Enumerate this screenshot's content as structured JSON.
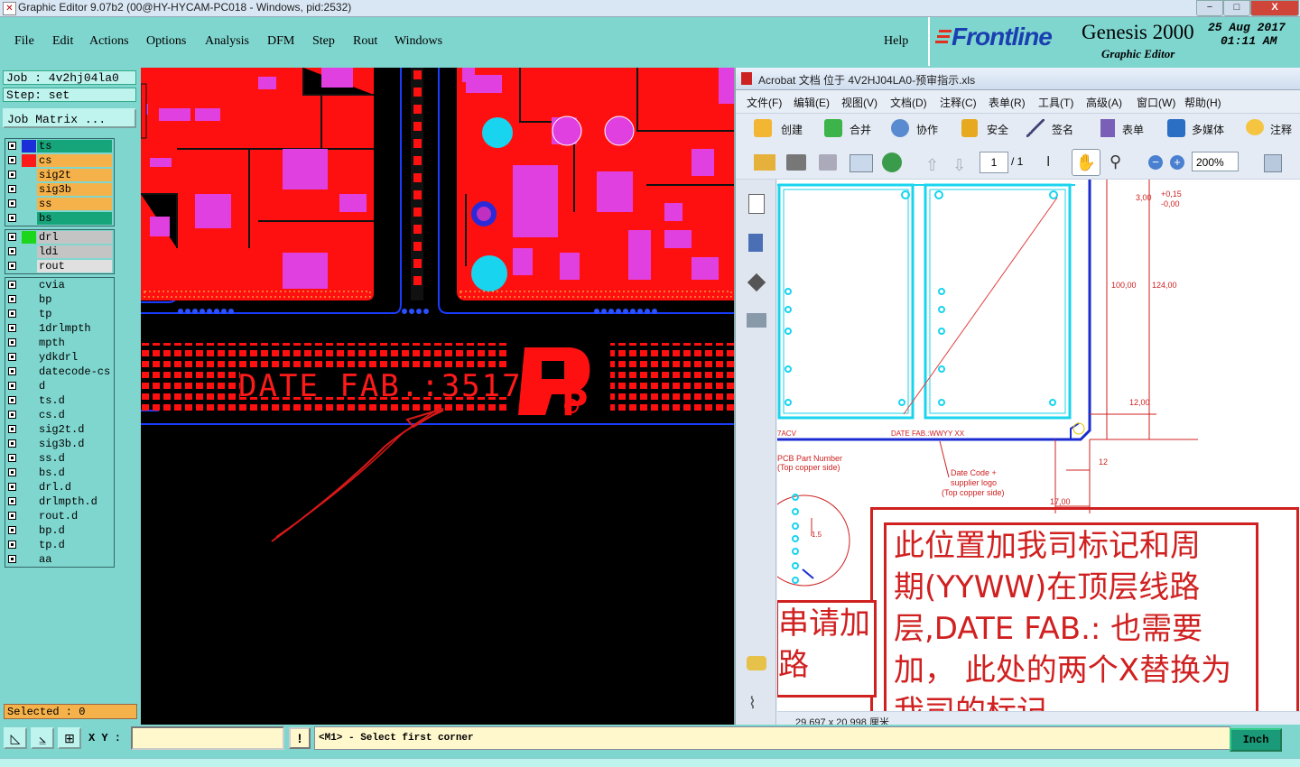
{
  "window": {
    "title": "Graphic Editor 9.07b2 (00@HY-HYCAM-PC018 - Windows, pid:2532)",
    "min": "−",
    "max": "□",
    "close": "X"
  },
  "menu": [
    "File",
    "Edit",
    "Actions",
    "Options",
    "Analysis",
    "DFM",
    "Step",
    "Rout",
    "Windows"
  ],
  "help": "Help",
  "brand": {
    "logo": "Frontline",
    "product": "Genesis 2000",
    "subtitle": "Graphic Editor",
    "date": "25 Aug 2017",
    "time": "01:11 AM"
  },
  "job": {
    "job": "Job : 4v2hj04la0",
    "step": "Step: set",
    "matrix_button": "Job Matrix ..."
  },
  "layers_group1": [
    {
      "name": "ts",
      "color": "#1c2ed8",
      "bg": "#16a57a"
    },
    {
      "name": "cs",
      "color": "#ff1a1a",
      "bg": "#f6b24a"
    },
    {
      "name": "sig2t",
      "color": "",
      "bg": "#f6b24a"
    },
    {
      "name": "sig3b",
      "color": "",
      "bg": "#f6b24a"
    },
    {
      "name": "ss",
      "color": "",
      "bg": "#f6b24a"
    },
    {
      "name": "bs",
      "color": "",
      "bg": "#16a57a"
    }
  ],
  "layers_group2": [
    {
      "name": "drl",
      "color": "#1cd61c",
      "bg": "#c4c4c4"
    },
    {
      "name": "ldi",
      "color": "",
      "bg": "#c4c4c4"
    },
    {
      "name": "rout",
      "color": "",
      "bg": "#e0e0e0"
    }
  ],
  "layers_group3": [
    "cvia",
    "bp",
    "tp",
    "1drlmpth",
    "mpth",
    "ydkdrl",
    "datecode-cs",
    "d",
    "ts.d",
    "cs.d",
    "sig2t.d",
    "sig3b.d",
    "ss.d",
    "bs.d",
    "drl.d",
    "drlmpth.d",
    "rout.d",
    "bp.d",
    "tp.d",
    "aa"
  ],
  "selected": "Selected : 0",
  "bottom": {
    "xy_label": "X Y :",
    "xy_value": "",
    "prompt": "<M1> - Select first corner",
    "units": "Inch"
  },
  "pcb": {
    "silk_text": "DATE FAB.:3517",
    "logo_letter": "P"
  },
  "acrobat": {
    "title": "Acrobat 文档 位于 4V2HJ04LA0-预审指示.xls",
    "menu": [
      "文件(F)",
      "编辑(E)",
      "视图(V)",
      "文档(D)",
      "注释(C)",
      "表单(R)",
      "工具(T)",
      "高级(A)",
      "窗口(W)",
      "帮助(H)"
    ],
    "toolbar": [
      "创建",
      "合并",
      "协作",
      "安全",
      "签名",
      "表单",
      "多媒体",
      "注释"
    ],
    "page_current": "1",
    "page_total": "/ 1",
    "zoom": "200%",
    "page_size": "29.697 x 20.998 厘米",
    "drawing": {
      "dim_300": "3,00",
      "tol_plus": "+0,15",
      "tol_minus": "-0,00",
      "dim_100": "100,00",
      "dim_124": "124,00",
      "dim_12": "12,00",
      "dim_12b": "12",
      "dim_17": "17,00",
      "dim_15": "1.5",
      "label_7acv": "7ACV",
      "label_datefab": "DATE FAB.:WWYY XX",
      "label_pcb1": "PCB Part Number",
      "label_pcb2": "(Top copper side)",
      "label_dc1": "Date Code +",
      "label_dc2": "supplier logo",
      "label_dc3": "(Top copper side)"
    },
    "note_main": [
      "此位置加我司标记和周",
      "期(YYWW)在顶层线路",
      "层,DATE FAB.: 也需要",
      "加， 此处的两个X替换为",
      "我司的标记"
    ],
    "note_left": [
      "串请加",
      "路"
    ]
  }
}
